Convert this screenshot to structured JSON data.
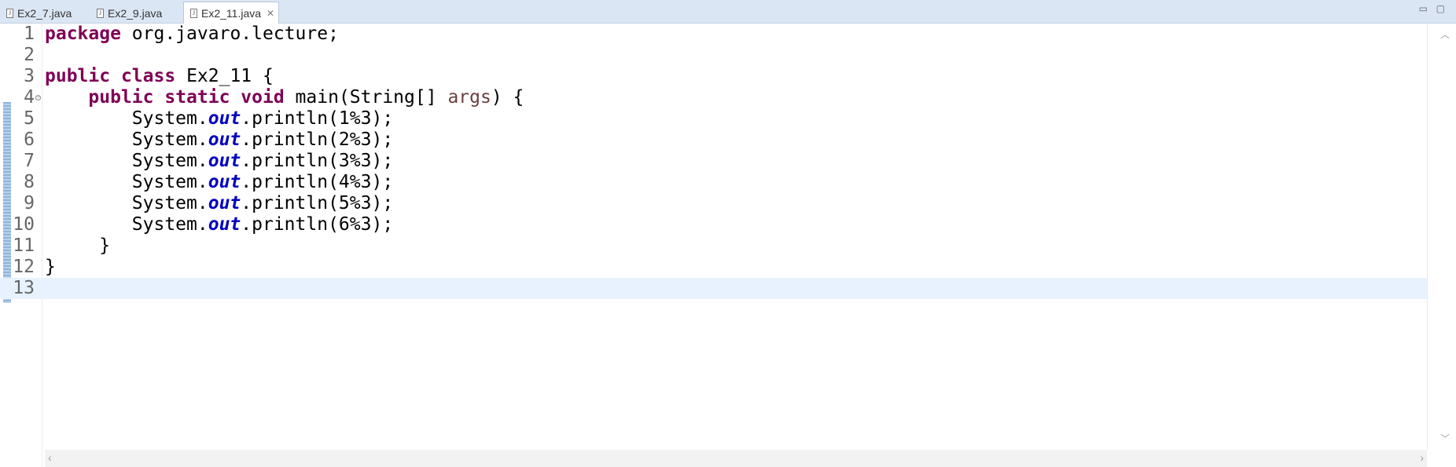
{
  "tabs": [
    {
      "label": "Ex2_7.java",
      "active": false
    },
    {
      "label": "Ex2_9.java",
      "active": false
    },
    {
      "label": "Ex2_11.java",
      "active": true
    }
  ],
  "editor": {
    "current_line": 13,
    "lines": [
      {
        "num": "1",
        "code": "package org.javaro.lecture;"
      },
      {
        "num": "2",
        "code": ""
      },
      {
        "num": "3",
        "code": "public class Ex2_11 {"
      },
      {
        "num": "4",
        "code": "    public static void main(String[] args) {"
      },
      {
        "num": "5",
        "code": "        System.out.println(1%3);"
      },
      {
        "num": "6",
        "code": "        System.out.println(2%3);"
      },
      {
        "num": "7",
        "code": "        System.out.println(3%3);"
      },
      {
        "num": "8",
        "code": "        System.out.println(4%3);"
      },
      {
        "num": "9",
        "code": "        System.out.println(5%3);"
      },
      {
        "num": "10",
        "code": "        System.out.println(6%3);"
      },
      {
        "num": "11",
        "code": "     }"
      },
      {
        "num": "12",
        "code": "}"
      },
      {
        "num": "13",
        "code": ""
      }
    ]
  },
  "colors": {
    "keyword": "#7f0055",
    "static_field": "#0000c0",
    "parameter": "#6a3e3e",
    "current_line_bg": "#e8f2fe",
    "tabbar_bg": "#dbe6f4"
  },
  "icons": {
    "tab_file": "java-file-icon",
    "tab_close": "close-icon",
    "minimize": "minimize-icon",
    "maximize": "maximize-icon",
    "fold": "fold-collapse-icon"
  }
}
